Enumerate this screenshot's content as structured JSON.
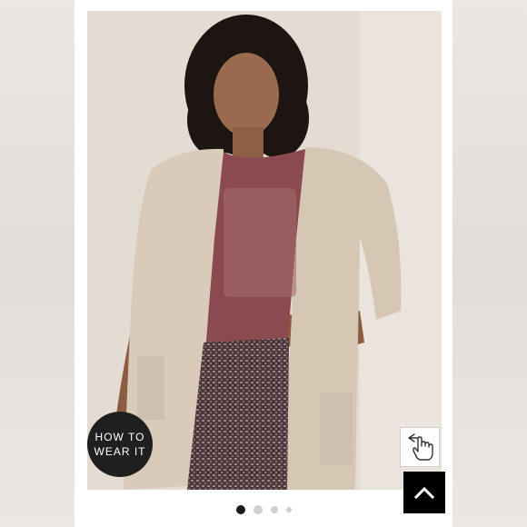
{
  "product_gallery": {
    "how_to_wear": {
      "line1": "HOW TO",
      "line2": "WEAR IT"
    },
    "swipe_hint_icon": "hand-pointer-swipe-icon",
    "scroll_top_icon": "chevron-up-icon",
    "pagination": {
      "total": 4,
      "active_index": 0
    },
    "colors": {
      "button_dark": "#1f1f1f",
      "scroll_top": "#000000",
      "dot_active": "#1a1a1a",
      "dot_inactive": "#cfcfcf"
    }
  }
}
